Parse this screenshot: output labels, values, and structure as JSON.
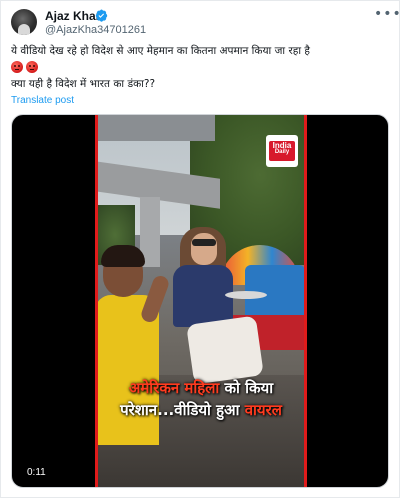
{
  "author": {
    "name": "Ajaz Khan",
    "handle": "@AjazKha34701261",
    "verified": true
  },
  "tweet": {
    "line1": "ये वीडियो देख रहे हो विदेश से आए मेहमान का कितना अपमान किया जा रहा है",
    "emojis": [
      "angry-face-icon",
      "angry-face-icon"
    ],
    "line2": "क्या यही है विदेश में भारत का डंका??",
    "translate_label": "Translate post"
  },
  "video": {
    "logo_top": "India",
    "logo_bottom": "Daily",
    "caption_line1_hl": "अमेरिकन महिला",
    "caption_line1_rest": " को किया",
    "caption_line2_rest": "परेशान...वीडियो हुआ ",
    "caption_line2_hl": "वायरल",
    "timestamp": "0:11"
  },
  "colors": {
    "link": "#1d9bf0",
    "verified": "#1d9bf0",
    "caption_highlight": "#ff3b1f",
    "frame_border": "#e01b1b"
  }
}
